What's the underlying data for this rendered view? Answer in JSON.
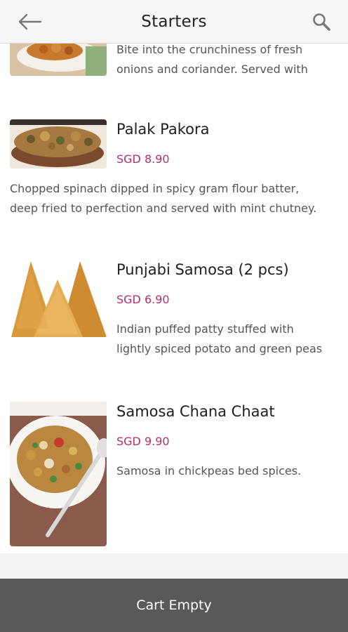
{
  "header": {
    "title": "Starters",
    "back_icon": "arrow-left-icon",
    "search_icon": "search-icon"
  },
  "colors": {
    "price": "#b0306e",
    "cart_bar": "#595959",
    "header_bg": "#f6f6f6"
  },
  "items": [
    {
      "name": "",
      "price": "",
      "description_lines": [
        "Bite into the crunchiness of fresh",
        "onions and coriander. Served with"
      ]
    },
    {
      "name": "Palak Pakora",
      "price": "SGD 8.90",
      "description_lines": [
        "Chopped spinach dipped in spicy gram flour batter,",
        "deep fried to perfection and served with mint chutney."
      ]
    },
    {
      "name": "Punjabi Samosa (2 pcs)",
      "price": "SGD 6.90",
      "description_lines": [
        "Indian puffed patty stuffed with",
        "lightly spiced potato and green peas"
      ]
    },
    {
      "name": "Samosa Chana Chaat",
      "price": "SGD 9.90",
      "description_lines": [
        "Samosa in chickpeas bed spices."
      ]
    }
  ],
  "cart": {
    "label": "Cart Empty"
  }
}
